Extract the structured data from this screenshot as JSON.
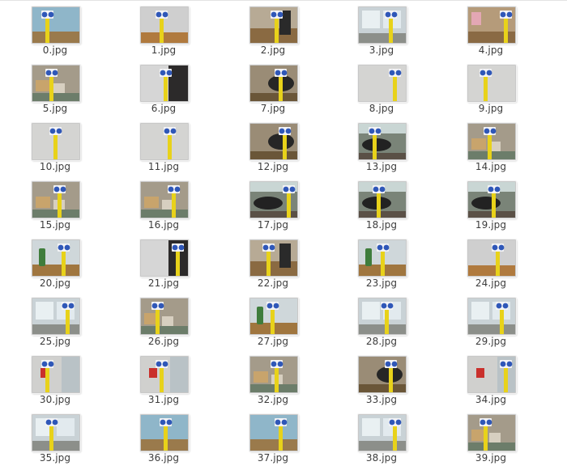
{
  "files": [
    {
      "name": "0.jpg",
      "scene": "wall-blue"
    },
    {
      "name": "1.jpg",
      "scene": "wall-floor"
    },
    {
      "name": "2.jpg",
      "scene": "floor-dark"
    },
    {
      "name": "3.jpg",
      "scene": "window"
    },
    {
      "name": "4.jpg",
      "scene": "office-pink"
    },
    {
      "name": "5.jpg",
      "scene": "office-boxes"
    },
    {
      "name": "6.jpg",
      "scene": "dark-side"
    },
    {
      "name": "7.jpg",
      "scene": "chair-dark"
    },
    {
      "name": "8.jpg",
      "scene": "wall-plain"
    },
    {
      "name": "9.jpg",
      "scene": "wall-plain"
    },
    {
      "name": "10.jpg",
      "scene": "wall-plain"
    },
    {
      "name": "11.jpg",
      "scene": "wall-plain"
    },
    {
      "name": "12.jpg",
      "scene": "chair-dark"
    },
    {
      "name": "13.jpg",
      "scene": "chair-window"
    },
    {
      "name": "14.jpg",
      "scene": "office-boxes"
    },
    {
      "name": "15.jpg",
      "scene": "office-boxes"
    },
    {
      "name": "16.jpg",
      "scene": "office-boxes"
    },
    {
      "name": "17.jpg",
      "scene": "chair-window"
    },
    {
      "name": "18.jpg",
      "scene": "chair-window"
    },
    {
      "name": "19.jpg",
      "scene": "chair-window"
    },
    {
      "name": "20.jpg",
      "scene": "extinguisher"
    },
    {
      "name": "21.jpg",
      "scene": "dark-side"
    },
    {
      "name": "22.jpg",
      "scene": "floor-dark"
    },
    {
      "name": "23.jpg",
      "scene": "extinguisher"
    },
    {
      "name": "24.jpg",
      "scene": "wall-floor"
    },
    {
      "name": "25.jpg",
      "scene": "window"
    },
    {
      "name": "26.jpg",
      "scene": "office-boxes"
    },
    {
      "name": "27.jpg",
      "scene": "extinguisher"
    },
    {
      "name": "28.jpg",
      "scene": "window"
    },
    {
      "name": "29.jpg",
      "scene": "window"
    },
    {
      "name": "30.jpg",
      "scene": "red-sign"
    },
    {
      "name": "31.jpg",
      "scene": "red-sign"
    },
    {
      "name": "32.jpg",
      "scene": "office-boxes"
    },
    {
      "name": "33.jpg",
      "scene": "chair-dark"
    },
    {
      "name": "34.jpg",
      "scene": "red-sign"
    },
    {
      "name": "35.jpg",
      "scene": "window"
    },
    {
      "name": "36.jpg",
      "scene": "wall-blue"
    },
    {
      "name": "37.jpg",
      "scene": "wall-blue"
    },
    {
      "name": "38.jpg",
      "scene": "window"
    },
    {
      "name": "39.jpg",
      "scene": "office-boxes"
    }
  ],
  "colors": {
    "pole": "#e8d21a",
    "sign_blue": "#2f57b8",
    "caption": "#3c3c3c"
  },
  "icons": {
    "thumbnail": "image-thumbnail-icon"
  }
}
